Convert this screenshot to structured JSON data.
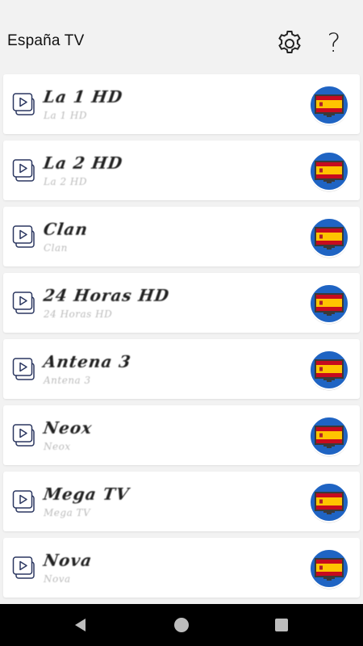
{
  "app": {
    "title": "España TV"
  },
  "channels": [
    {
      "name": "La 1 HD",
      "subtitle": "La 1 HD"
    },
    {
      "name": "La 2 HD",
      "subtitle": "La 2 HD"
    },
    {
      "name": "Clan",
      "subtitle": "Clan"
    },
    {
      "name": "24 Horas HD",
      "subtitle": "24 Horas HD"
    },
    {
      "name": "Antena 3",
      "subtitle": "Antena 3"
    },
    {
      "name": "Neox",
      "subtitle": "Neox"
    },
    {
      "name": "Mega TV",
      "subtitle": "Mega TV"
    },
    {
      "name": "Nova",
      "subtitle": "Nova"
    }
  ],
  "icons": {
    "settings": "gear-icon",
    "help": "question-mark-icon",
    "channel_play": "play-icon",
    "channel_flag": "spain-flag-tv-icon"
  },
  "colors": {
    "accent_blue": "#1f64c3",
    "flag_red": "#c60b1e",
    "flag_yellow": "#ffc400"
  },
  "help_glyph": "?"
}
